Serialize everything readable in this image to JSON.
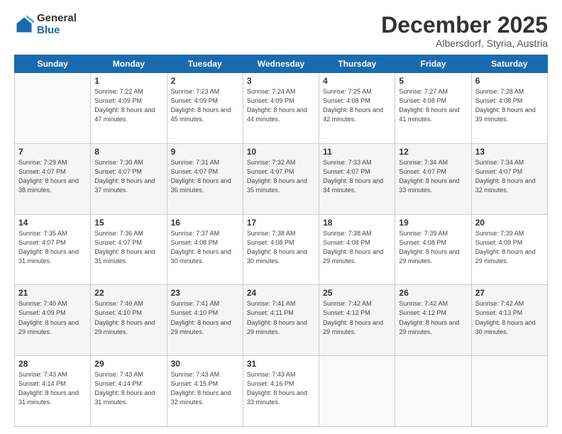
{
  "logo": {
    "general": "General",
    "blue": "Blue"
  },
  "header": {
    "month": "December 2025",
    "location": "Albersdorf, Styria, Austria"
  },
  "days_of_week": [
    "Sunday",
    "Monday",
    "Tuesday",
    "Wednesday",
    "Thursday",
    "Friday",
    "Saturday"
  ],
  "weeks": [
    [
      {
        "day": "",
        "sunrise": "",
        "sunset": "",
        "daylight": "",
        "empty": true
      },
      {
        "day": "1",
        "sunrise": "Sunrise: 7:22 AM",
        "sunset": "Sunset: 4:09 PM",
        "daylight": "Daylight: 8 hours and 47 minutes."
      },
      {
        "day": "2",
        "sunrise": "Sunrise: 7:23 AM",
        "sunset": "Sunset: 4:09 PM",
        "daylight": "Daylight: 8 hours and 45 minutes."
      },
      {
        "day": "3",
        "sunrise": "Sunrise: 7:24 AM",
        "sunset": "Sunset: 4:09 PM",
        "daylight": "Daylight: 8 hours and 44 minutes."
      },
      {
        "day": "4",
        "sunrise": "Sunrise: 7:25 AM",
        "sunset": "Sunset: 4:08 PM",
        "daylight": "Daylight: 8 hours and 42 minutes."
      },
      {
        "day": "5",
        "sunrise": "Sunrise: 7:27 AM",
        "sunset": "Sunset: 4:08 PM",
        "daylight": "Daylight: 8 hours and 41 minutes."
      },
      {
        "day": "6",
        "sunrise": "Sunrise: 7:28 AM",
        "sunset": "Sunset: 4:08 PM",
        "daylight": "Daylight: 8 hours and 39 minutes."
      }
    ],
    [
      {
        "day": "7",
        "sunrise": "Sunrise: 7:29 AM",
        "sunset": "Sunset: 4:07 PM",
        "daylight": "Daylight: 8 hours and 38 minutes."
      },
      {
        "day": "8",
        "sunrise": "Sunrise: 7:30 AM",
        "sunset": "Sunset: 4:07 PM",
        "daylight": "Daylight: 8 hours and 37 minutes."
      },
      {
        "day": "9",
        "sunrise": "Sunrise: 7:31 AM",
        "sunset": "Sunset: 4:07 PM",
        "daylight": "Daylight: 8 hours and 36 minutes."
      },
      {
        "day": "10",
        "sunrise": "Sunrise: 7:32 AM",
        "sunset": "Sunset: 4:07 PM",
        "daylight": "Daylight: 8 hours and 35 minutes."
      },
      {
        "day": "11",
        "sunrise": "Sunrise: 7:33 AM",
        "sunset": "Sunset: 4:07 PM",
        "daylight": "Daylight: 8 hours and 34 minutes."
      },
      {
        "day": "12",
        "sunrise": "Sunrise: 7:34 AM",
        "sunset": "Sunset: 4:07 PM",
        "daylight": "Daylight: 8 hours and 33 minutes."
      },
      {
        "day": "13",
        "sunrise": "Sunrise: 7:34 AM",
        "sunset": "Sunset: 4:07 PM",
        "daylight": "Daylight: 8 hours and 32 minutes."
      }
    ],
    [
      {
        "day": "14",
        "sunrise": "Sunrise: 7:35 AM",
        "sunset": "Sunset: 4:07 PM",
        "daylight": "Daylight: 8 hours and 31 minutes."
      },
      {
        "day": "15",
        "sunrise": "Sunrise: 7:36 AM",
        "sunset": "Sunset: 4:07 PM",
        "daylight": "Daylight: 8 hours and 31 minutes."
      },
      {
        "day": "16",
        "sunrise": "Sunrise: 7:37 AM",
        "sunset": "Sunset: 4:08 PM",
        "daylight": "Daylight: 8 hours and 30 minutes."
      },
      {
        "day": "17",
        "sunrise": "Sunrise: 7:38 AM",
        "sunset": "Sunset: 4:08 PM",
        "daylight": "Daylight: 8 hours and 30 minutes."
      },
      {
        "day": "18",
        "sunrise": "Sunrise: 7:38 AM",
        "sunset": "Sunset: 4:08 PM",
        "daylight": "Daylight: 8 hours and 29 minutes."
      },
      {
        "day": "19",
        "sunrise": "Sunrise: 7:39 AM",
        "sunset": "Sunset: 4:08 PM",
        "daylight": "Daylight: 8 hours and 29 minutes."
      },
      {
        "day": "20",
        "sunrise": "Sunrise: 7:39 AM",
        "sunset": "Sunset: 4:09 PM",
        "daylight": "Daylight: 8 hours and 29 minutes."
      }
    ],
    [
      {
        "day": "21",
        "sunrise": "Sunrise: 7:40 AM",
        "sunset": "Sunset: 4:09 PM",
        "daylight": "Daylight: 8 hours and 29 minutes."
      },
      {
        "day": "22",
        "sunrise": "Sunrise: 7:40 AM",
        "sunset": "Sunset: 4:10 PM",
        "daylight": "Daylight: 8 hours and 29 minutes."
      },
      {
        "day": "23",
        "sunrise": "Sunrise: 7:41 AM",
        "sunset": "Sunset: 4:10 PM",
        "daylight": "Daylight: 8 hours and 29 minutes."
      },
      {
        "day": "24",
        "sunrise": "Sunrise: 7:41 AM",
        "sunset": "Sunset: 4:11 PM",
        "daylight": "Daylight: 8 hours and 29 minutes."
      },
      {
        "day": "25",
        "sunrise": "Sunrise: 7:42 AM",
        "sunset": "Sunset: 4:12 PM",
        "daylight": "Daylight: 8 hours and 29 minutes."
      },
      {
        "day": "26",
        "sunrise": "Sunrise: 7:42 AM",
        "sunset": "Sunset: 4:12 PM",
        "daylight": "Daylight: 8 hours and 29 minutes."
      },
      {
        "day": "27",
        "sunrise": "Sunrise: 7:42 AM",
        "sunset": "Sunset: 4:13 PM",
        "daylight": "Daylight: 8 hours and 30 minutes."
      }
    ],
    [
      {
        "day": "28",
        "sunrise": "Sunrise: 7:43 AM",
        "sunset": "Sunset: 4:14 PM",
        "daylight": "Daylight: 8 hours and 31 minutes."
      },
      {
        "day": "29",
        "sunrise": "Sunrise: 7:43 AM",
        "sunset": "Sunset: 4:14 PM",
        "daylight": "Daylight: 8 hours and 31 minutes."
      },
      {
        "day": "30",
        "sunrise": "Sunrise: 7:43 AM",
        "sunset": "Sunset: 4:15 PM",
        "daylight": "Daylight: 8 hours and 32 minutes."
      },
      {
        "day": "31",
        "sunrise": "Sunrise: 7:43 AM",
        "sunset": "Sunset: 4:16 PM",
        "daylight": "Daylight: 8 hours and 33 minutes."
      },
      {
        "day": "",
        "sunrise": "",
        "sunset": "",
        "daylight": "",
        "empty": true
      },
      {
        "day": "",
        "sunrise": "",
        "sunset": "",
        "daylight": "",
        "empty": true
      },
      {
        "day": "",
        "sunrise": "",
        "sunset": "",
        "daylight": "",
        "empty": true
      }
    ]
  ]
}
